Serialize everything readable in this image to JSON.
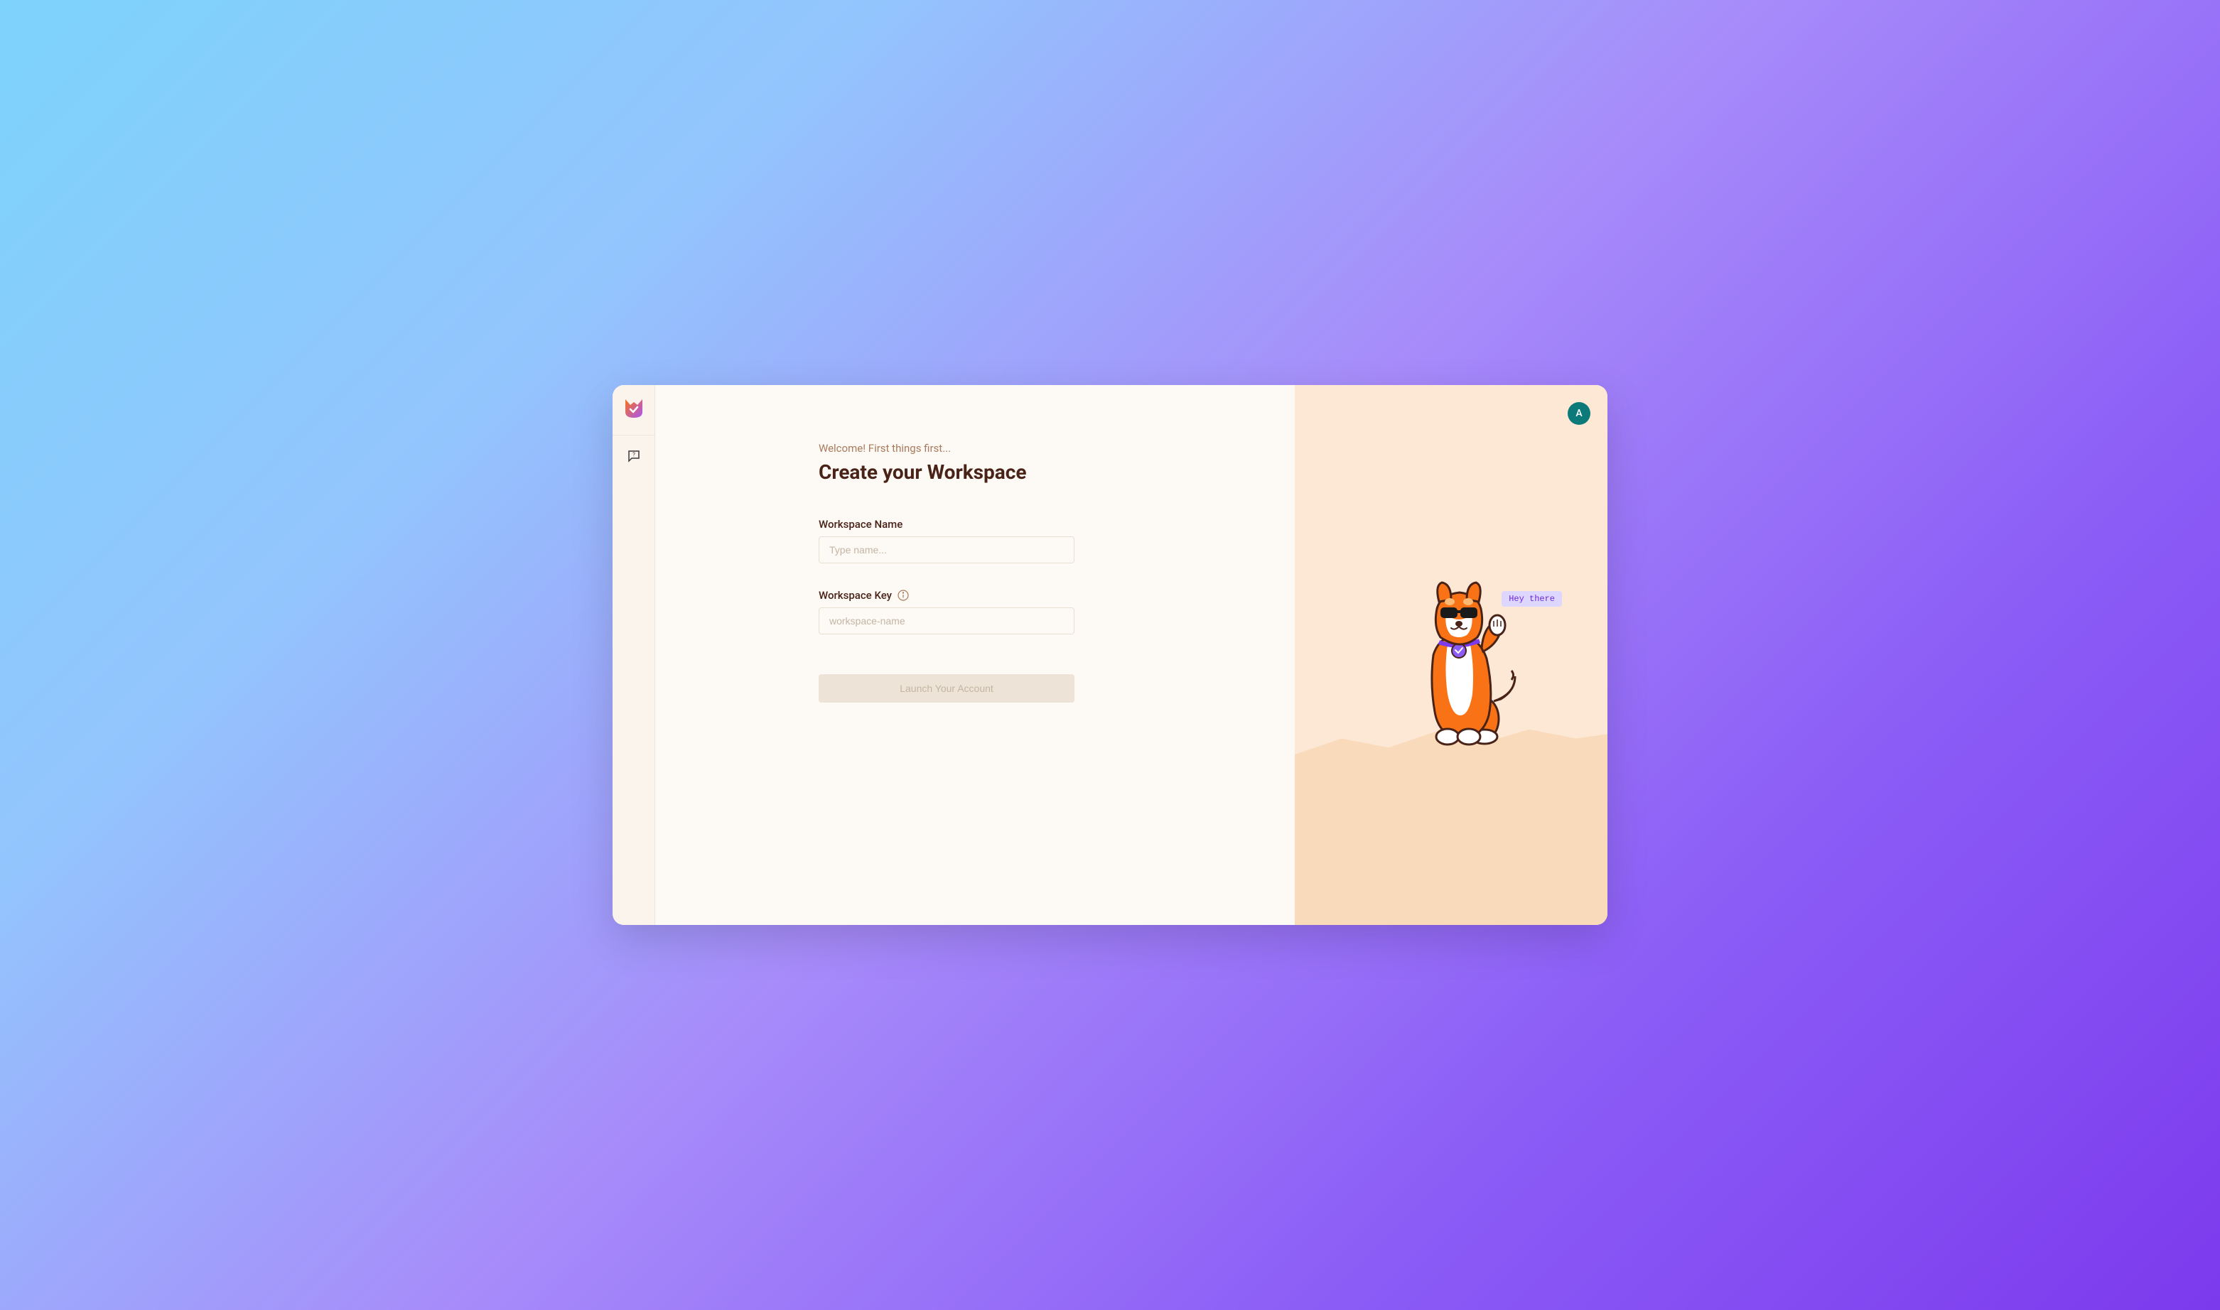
{
  "header": {
    "subtitle": "Welcome! First things first...",
    "title": "Create your Workspace"
  },
  "form": {
    "workspaceName": {
      "label": "Workspace Name",
      "placeholder": "Type name...",
      "value": ""
    },
    "workspaceKey": {
      "label": "Workspace Key",
      "placeholder": "workspace-name",
      "value": ""
    },
    "submitLabel": "Launch Your Account"
  },
  "avatar": {
    "initial": "A"
  },
  "mascot": {
    "speechText": "Hey there"
  },
  "sidebar": {
    "logoName": "app-logo",
    "helpName": "help-icon"
  }
}
